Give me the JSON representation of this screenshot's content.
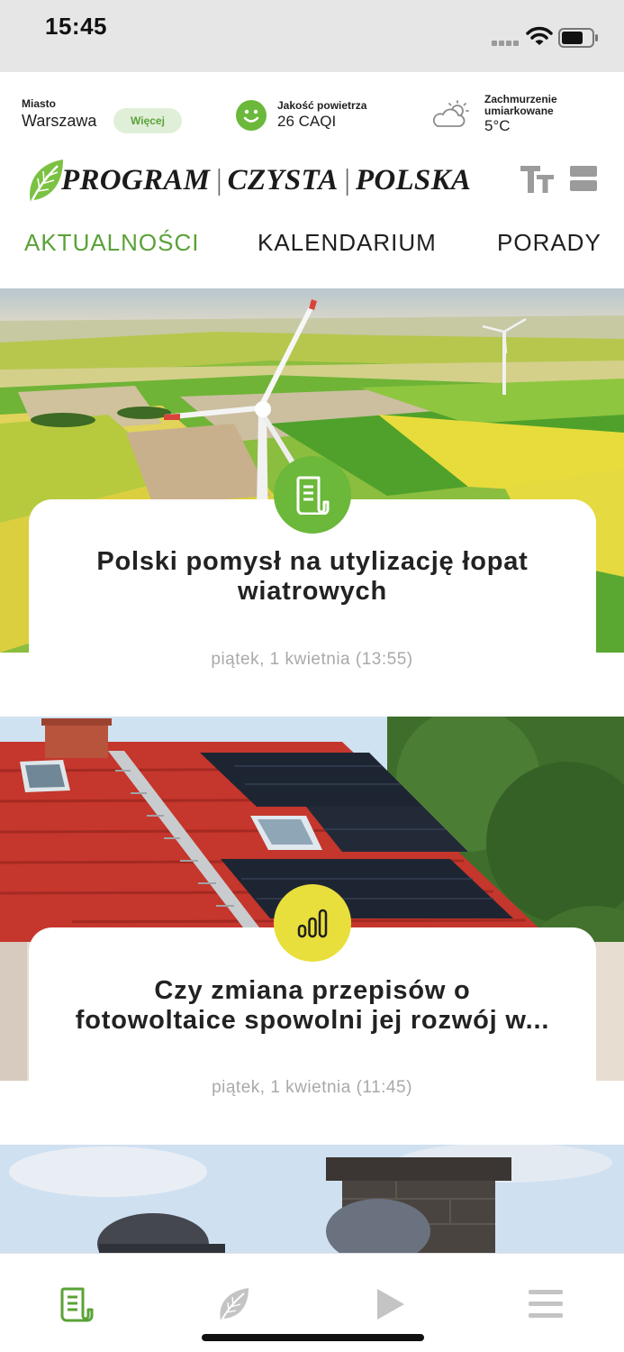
{
  "status_bar": {
    "time": "15:45"
  },
  "info": {
    "city_label": "Miasto",
    "city_name": "Warszawa",
    "more_button": "Więcej",
    "air_label": "Jakość powietrza",
    "air_value": "26 CAQI",
    "weather_label_line1": "Zachmurzenie",
    "weather_label_line2": "umiarkowane",
    "temperature": "5°C"
  },
  "header": {
    "logo_part1": "PROGRAM",
    "logo_part2": "CZYSTA",
    "logo_part3": "POLSKA",
    "logo_separator": "|"
  },
  "tabs": [
    {
      "label": "AKTUALNOŚCI",
      "active": true
    },
    {
      "label": "KALENDARIUM",
      "active": false
    },
    {
      "label": "PORADY",
      "active": false
    }
  ],
  "articles": [
    {
      "title_line1": "Polski pomysł na utylizację łopat",
      "title_line2": "wiatrowych",
      "date": "piątek, 1 kwietnia (13:55)",
      "icon": "article-icon",
      "badge_color": "#6bb83a"
    },
    {
      "title_line1": "Czy zmiana przepisów o",
      "title_line2": "fotowoltaice spowolni jej rozwój w...",
      "date": "piątek, 1 kwietnia (11:45)",
      "icon": "bar-chart-icon",
      "badge_color": "#e9df3c"
    }
  ],
  "bottom_nav": [
    {
      "icon": "news-icon",
      "active": true
    },
    {
      "icon": "leaf-icon",
      "active": false
    },
    {
      "icon": "play-icon",
      "active": false
    },
    {
      "icon": "menu-icon",
      "active": false
    }
  ],
  "colors": {
    "accent": "#5aa237",
    "chip_bg": "#e0efd8",
    "date_gray": "#a9a9a9"
  }
}
